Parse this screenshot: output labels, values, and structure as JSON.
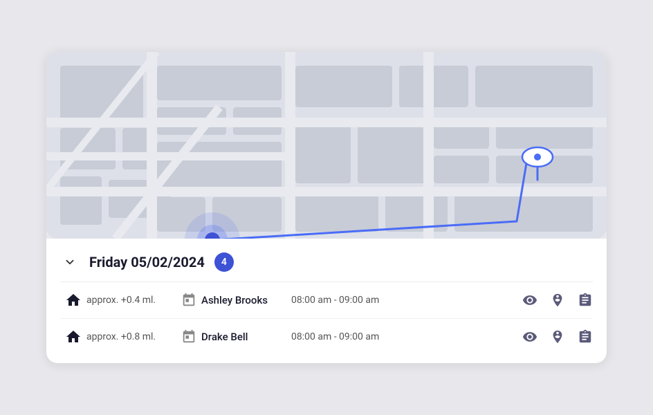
{
  "map": {
    "alt": "Map view showing route"
  },
  "date_header": {
    "label": "Friday 05/02/2024",
    "count": "4",
    "chevron": "chevron-down"
  },
  "trips": [
    {
      "id": 1,
      "distance": "approx. +0.4 ml.",
      "name": "Ashley Brooks",
      "time": "08:00 am - 09:00 am",
      "home": true
    },
    {
      "id": 2,
      "distance": "approx. +0.8 ml.",
      "name": "Drake Bell",
      "time": "08:00 am - 09:00 am",
      "home": true
    }
  ],
  "icons": {
    "chevron": "❮",
    "home": "⌂",
    "calendar": "📅",
    "eye": "👁",
    "person_pin": "person_pin",
    "assignment": "assignment"
  }
}
